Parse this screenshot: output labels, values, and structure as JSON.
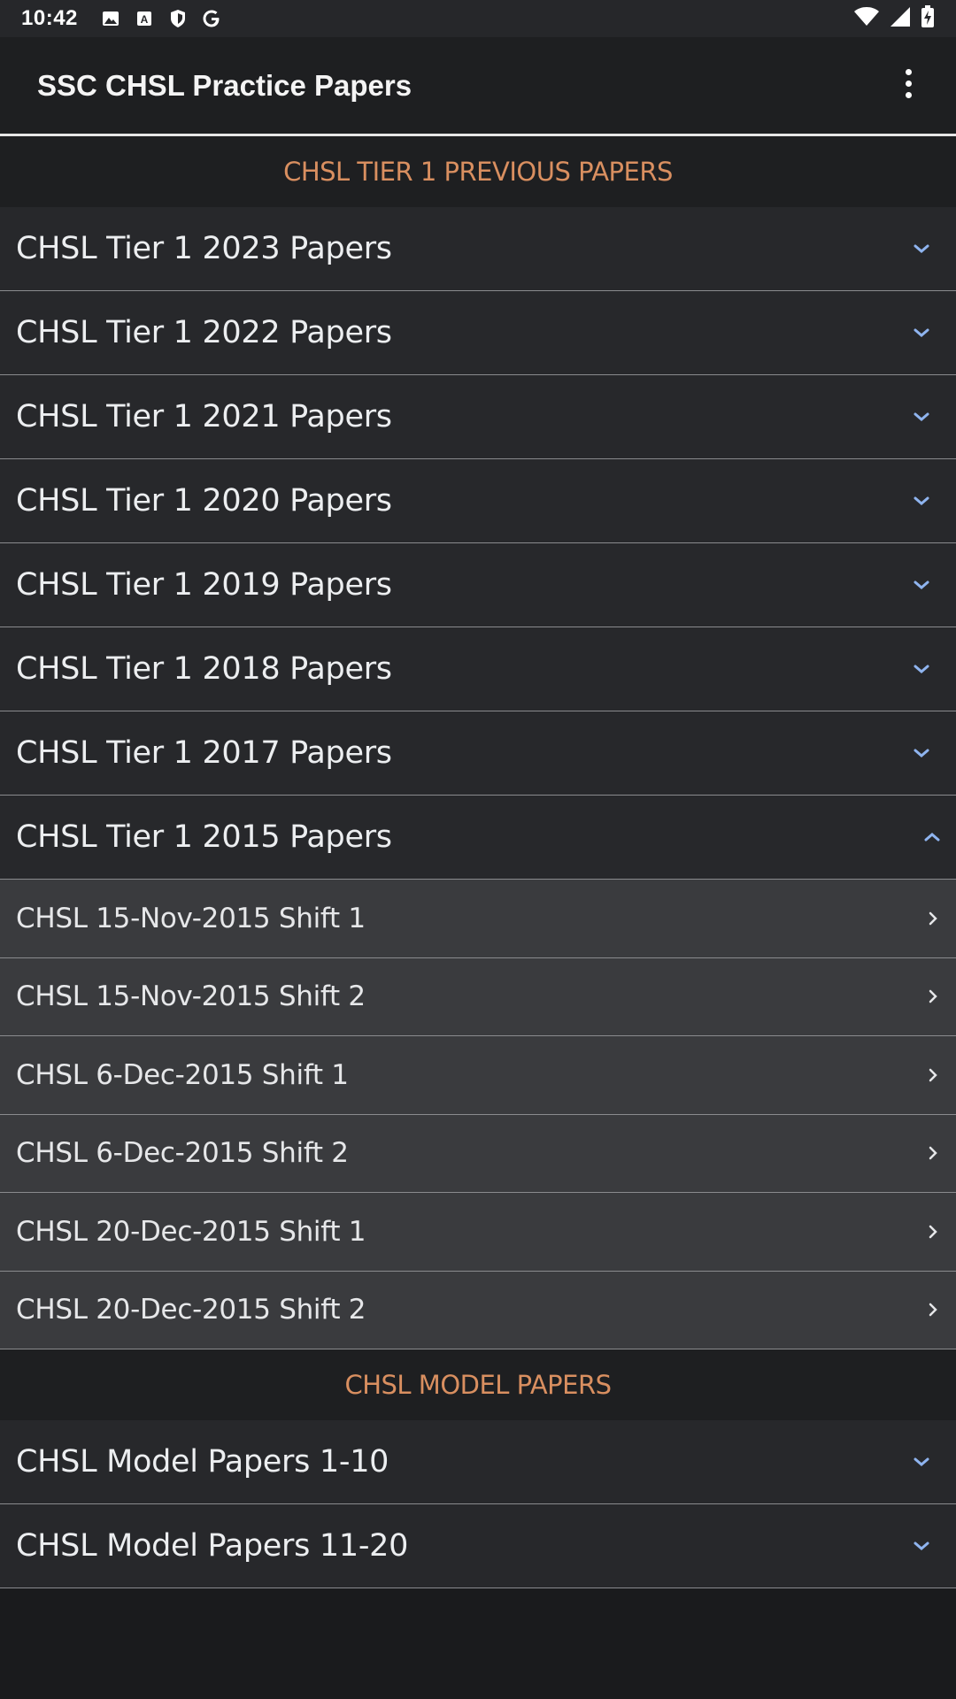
{
  "status_bar": {
    "time": "10:42",
    "left_icons": [
      "image-icon",
      "a-badge-icon",
      "shield-icon",
      "google-g-icon"
    ],
    "right_icons": [
      "wifi-icon",
      "cell-signal-icon",
      "battery-charging-icon"
    ]
  },
  "app_bar": {
    "title": "SSC CHSL Practice Papers",
    "menu_icon": "more-vert-icon"
  },
  "colors": {
    "background": "#1a1b1d",
    "section_header_text": "#d98f60",
    "chevron": "#8fb4ef",
    "group_row_bg": "#27282b",
    "child_row_bg": "#3a3b3e"
  },
  "sections": [
    {
      "header": "CHSL TIER 1 PREVIOUS PAPERS",
      "groups": [
        {
          "label": "CHSL Tier 1 2023 Papers",
          "expanded": false
        },
        {
          "label": "CHSL Tier 1 2022 Papers",
          "expanded": false
        },
        {
          "label": "CHSL Tier 1 2021 Papers",
          "expanded": false
        },
        {
          "label": "CHSL Tier 1 2020 Papers",
          "expanded": false
        },
        {
          "label": "CHSL Tier 1 2019 Papers",
          "expanded": false
        },
        {
          "label": "CHSL Tier 1 2018 Papers",
          "expanded": false
        },
        {
          "label": "CHSL Tier 1 2017 Papers",
          "expanded": false
        },
        {
          "label": "CHSL Tier 1 2015 Papers",
          "expanded": true,
          "children": [
            "CHSL 15-Nov-2015 Shift 1",
            "CHSL 15-Nov-2015 Shift 2",
            "CHSL 6-Dec-2015 Shift 1",
            "CHSL 6-Dec-2015 Shift 2",
            "CHSL 20-Dec-2015 Shift 1",
            "CHSL 20-Dec-2015 Shift 2"
          ]
        }
      ]
    },
    {
      "header": "CHSL MODEL PAPERS",
      "groups": [
        {
          "label": "CHSL Model Papers 1-10",
          "expanded": false
        },
        {
          "label": "CHSL Model Papers 11-20",
          "expanded": false
        }
      ]
    }
  ]
}
